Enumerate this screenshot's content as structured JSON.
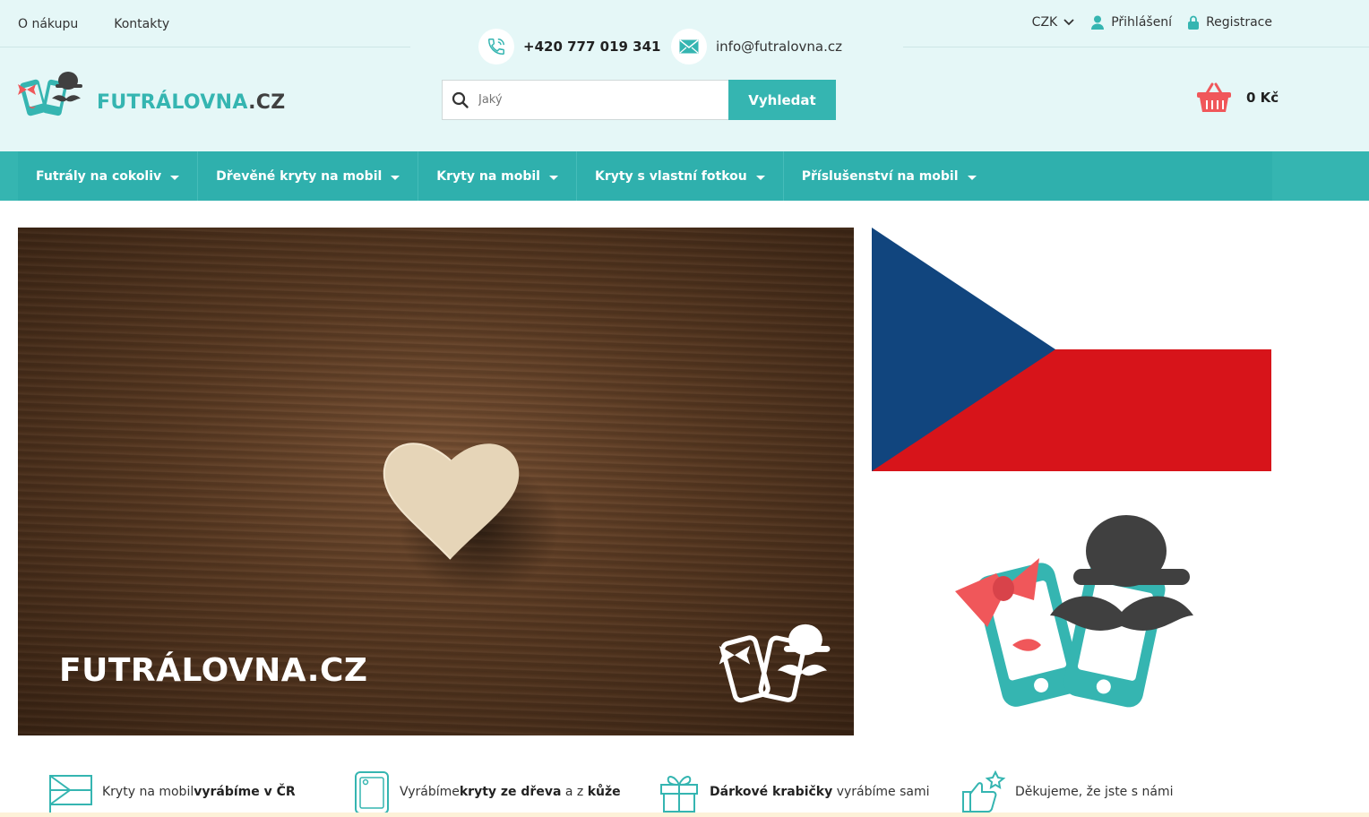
{
  "top_links": [
    "O nákupu",
    "Kontakty"
  ],
  "contact": {
    "phone": "+420 777 019 341",
    "email": "info@futralovna.cz"
  },
  "user_bar": {
    "currency": "CZK",
    "login": "Přihlášení",
    "register": "Registrace"
  },
  "logo": {
    "name": "FUTRÁLOVNA",
    "tld": ".CZ"
  },
  "search": {
    "placeholder": "Jaký",
    "button": "Vyhledat"
  },
  "cart": {
    "total": "0 Kč"
  },
  "nav": [
    "Futrály na cokoliv",
    "Dřevěné kryty na mobil",
    "Kryty na mobil",
    "Kryty s vlastní fotkou",
    "Příslušenství na mobil"
  ],
  "banner": {
    "text": "FUTRÁLOVNA.CZ"
  },
  "features": [
    {
      "pre": "Kryty na mobil ",
      "bold": "vyrábíme v ČR",
      "post": ""
    },
    {
      "pre": "Vyrábíme ",
      "bold": "kryty ze dřeva",
      "mid": " a z ",
      "bold2": "kůže",
      "post": ""
    },
    {
      "pre": "",
      "bold": "Dárkové krabičky",
      "post": " vyrábíme sami"
    },
    {
      "pre": "Děkujeme, že jste s námi",
      "bold": "",
      "post": ""
    }
  ],
  "colors": {
    "accent": "#35b5b1",
    "header_bg": "#e5f7f7",
    "cart": "#f0575a",
    "flag_blue": "#11457e",
    "flag_red": "#d7141a"
  }
}
